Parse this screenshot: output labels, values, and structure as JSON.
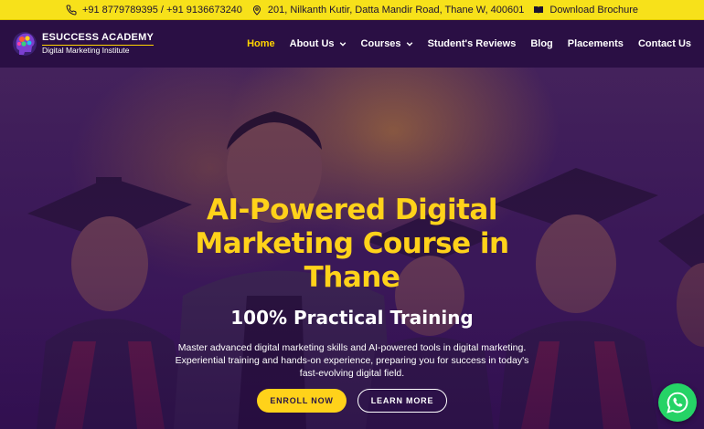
{
  "topbar": {
    "phone": "+91 8779789395 / +91 9136673240",
    "address": "201, Nilkanth Kutir, Datta Mandir Road, Thane W, 400601",
    "brochure": "Download Brochure",
    "icons": [
      "phone-icon",
      "location-pin-icon",
      "book-icon"
    ]
  },
  "logo": {
    "title": "ESUCCESS ACADEMY",
    "subtitle": "Digital Marketing Institute"
  },
  "nav": {
    "items": [
      {
        "label": "Home",
        "active": true,
        "dropdown": false
      },
      {
        "label": "About Us",
        "active": false,
        "dropdown": true
      },
      {
        "label": "Courses",
        "active": false,
        "dropdown": true
      },
      {
        "label": "Student's Reviews",
        "active": false,
        "dropdown": false
      },
      {
        "label": "Blog",
        "active": false,
        "dropdown": false
      },
      {
        "label": "Placements",
        "active": false,
        "dropdown": false
      },
      {
        "label": "Contact Us",
        "active": false,
        "dropdown": false
      }
    ]
  },
  "hero": {
    "headline_line1": "AI-Powered Digital",
    "headline_line2": "Marketing Course in",
    "headline_line3": "Thane",
    "subheadline": "100% Practical Training",
    "description": "Master advanced digital marketing skills and AI-powered tools in digital marketing. Experiential training and hands-on experience, preparing you for success in today's fast-evolving digital field.",
    "enroll_label": "ENROLL NOW",
    "learn_label": "LEARN MORE"
  },
  "colors": {
    "topbar_bg": "#f7e11a",
    "nav_bg": "#2a0f44",
    "accent_yellow": "#ffd21a",
    "hero_overlay": "#3a145c",
    "whatsapp_green": "#25d366"
  },
  "floating": {
    "icon": "whatsapp-icon"
  }
}
